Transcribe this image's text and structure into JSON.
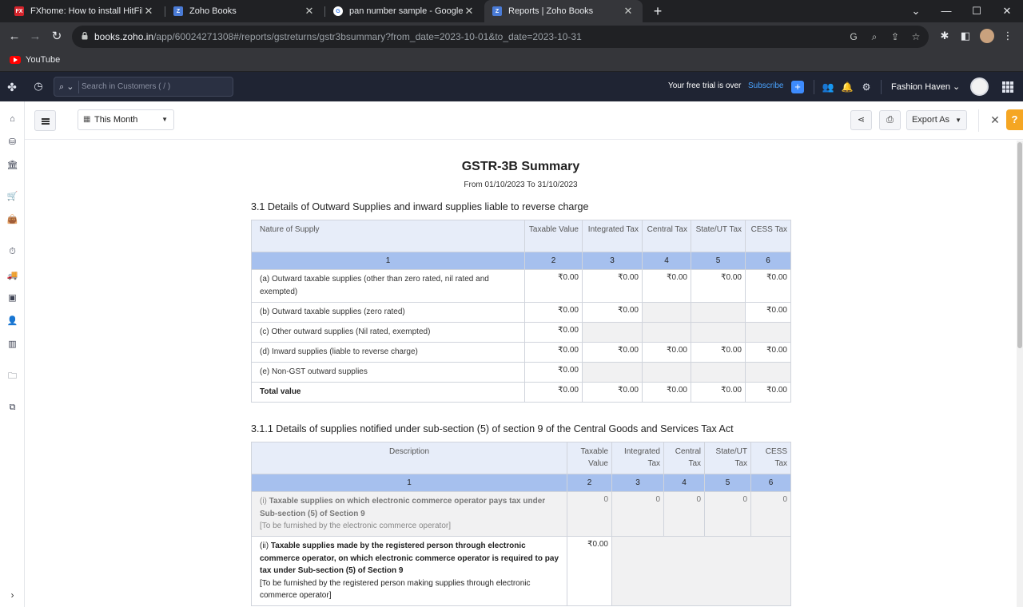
{
  "browser": {
    "tabs": [
      {
        "title": "FXhome: How to install HitFilm",
        "favicon": "FX"
      },
      {
        "title": "Zoho Books",
        "favicon": "Z"
      },
      {
        "title": "pan number sample - Google Se",
        "favicon": "G"
      },
      {
        "title": "Reports | Zoho Books",
        "favicon": "Z",
        "active": true
      }
    ],
    "url_host": "books.zoho.in",
    "url_path": "/app/60024271308#/reports/gstreturns/gstr3bsummary?from_date=2023-10-01&to_date=2023-10-31",
    "bookmarks": [
      "YouTube"
    ]
  },
  "header": {
    "search_placeholder": "Search in Customers ( / )",
    "trial_text": "Your free trial is over",
    "subscribe_label": "Subscribe",
    "org_name": "Fashion Haven"
  },
  "toolbar": {
    "period_label": "This Month",
    "export_label": "Export As"
  },
  "report": {
    "title": "GSTR-3B Summary",
    "range": "From 01/10/2023  To 31/10/2023",
    "section1": {
      "heading": "3.1 Details of Outward Supplies and inward supplies liable to reverse charge",
      "columns": [
        "Nature of Supply",
        "Taxable Value",
        "Integrated Tax",
        "Central Tax",
        "State/UT Tax",
        "CESS Tax"
      ],
      "col_numbers": [
        "1",
        "2",
        "3",
        "4",
        "5",
        "6"
      ],
      "rows": [
        {
          "label": "(a) Outward taxable supplies (other than zero rated, nil rated and exempted)",
          "values": [
            "₹0.00",
            "₹0.00",
            "₹0.00",
            "₹0.00",
            "₹0.00"
          ]
        },
        {
          "label": "(b) Outward taxable supplies (zero rated)",
          "values": [
            "₹0.00",
            "₹0.00",
            "",
            "",
            "₹0.00"
          ]
        },
        {
          "label": "(c) Other outward supplies (Nil rated, exempted)",
          "values": [
            "₹0.00",
            "",
            "",
            "",
            ""
          ]
        },
        {
          "label": "(d) Inward supplies (liable to reverse charge)",
          "values": [
            "₹0.00",
            "₹0.00",
            "₹0.00",
            "₹0.00",
            "₹0.00"
          ]
        },
        {
          "label": "(e) Non-GST outward supplies",
          "values": [
            "₹0.00",
            "",
            "",
            "",
            ""
          ]
        },
        {
          "label": "Total value",
          "values": [
            "₹0.00",
            "₹0.00",
            "₹0.00",
            "₹0.00",
            "₹0.00"
          ]
        }
      ]
    },
    "section2": {
      "heading": "3.1.1 Details of supplies notified under sub-section (5) of section 9 of the Central Goods and Services Tax Act",
      "columns": [
        "Description",
        "Taxable Value",
        "Integrated Tax",
        "Central Tax",
        "State/UT Tax",
        "CESS Tax"
      ],
      "col_numbers": [
        "1",
        "2",
        "3",
        "4",
        "5",
        "6"
      ],
      "rows": [
        {
          "prefix": "(i)",
          "label": "Taxable supplies on which electronic commerce operator pays tax under Sub-section (5) of Section 9",
          "note": "[To be furnished by the electronic commerce operator]",
          "values": [
            "0",
            "0",
            "0",
            "0",
            "0"
          ]
        },
        {
          "prefix": "(ii)",
          "label": "Taxable supplies made by the registered person through electronic commerce operator, on which electronic commerce operator is required to pay tax under Sub-section (5) of Section 9",
          "note": "[To be furnished by the registered person making supplies through electronic commerce operator]",
          "values": [
            "₹0.00"
          ]
        }
      ]
    }
  }
}
